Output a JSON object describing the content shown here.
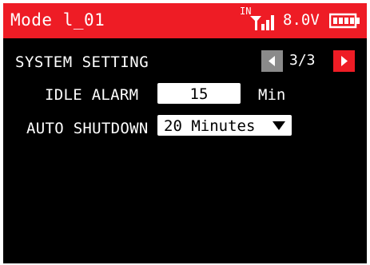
{
  "header": {
    "model_name": "Mode l_01",
    "input_label": "IN",
    "signal_icon": "signal-bars-icon",
    "voltage": "8.0V",
    "battery_icon": "battery-icon",
    "background_color": "#ee1c25"
  },
  "page": {
    "title": "SYSTEM SETTING",
    "indicator": "3/3",
    "prev_icon": "arrow-left-icon",
    "next_icon": "arrow-right-icon"
  },
  "settings": {
    "idle_alarm": {
      "label": "IDLE ALARM",
      "value": "15",
      "unit": "Min"
    },
    "auto_shutdown": {
      "label": "AUTO SHUTDOWN",
      "value": "20 Minutes",
      "arrow_icon": "dropdown-arrow-icon"
    }
  }
}
